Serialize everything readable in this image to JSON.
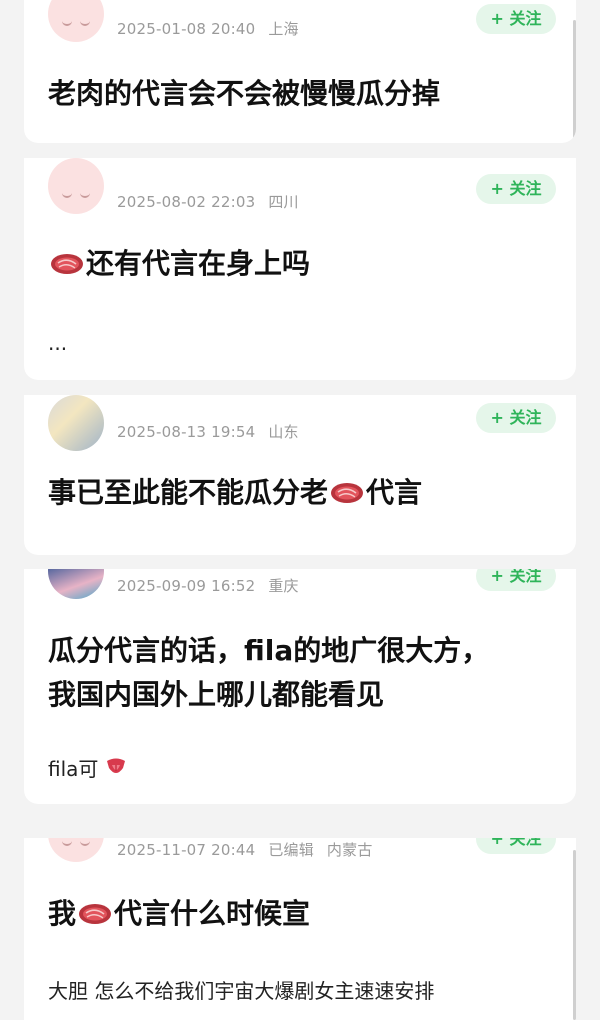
{
  "posts": [
    {
      "date": "2025-01-08 20:40",
      "location": "上海",
      "follow_label": "+ 关注",
      "title": "老肉的代言会不会被慢慢瓜分掉"
    },
    {
      "date": "2025-08-02 22:03",
      "location": "四川",
      "follow_label": "+ 关注",
      "title": "还有代言在身上吗",
      "body": "..."
    },
    {
      "date": "2025-08-13 19:54",
      "location": "山东",
      "follow_label": "+ 关注",
      "title_a": "事已至此能不能瓜分老",
      "title_b": "代言"
    },
    {
      "date": "2025-09-09 16:52",
      "location": "重庆",
      "follow_label": "+ 关注",
      "title_line1": "瓜分代言的话，fila的地广很大方，",
      "title_line2": "我国内国外上哪儿都能看见",
      "body": "fila可"
    },
    {
      "date": "2025-11-07 20:44",
      "edited": "已编辑",
      "location": "内蒙古",
      "follow_label": "+ 关注",
      "title_a": "我",
      "title_b": "代言什么时候宣",
      "body": "大胆 怎么不给我们宇宙大爆剧女主速速安排"
    }
  ],
  "icons": {
    "steak": "steak-emoji",
    "tongue": "tongue-emoji"
  },
  "colors": {
    "follow_bg": "#e5f6ea",
    "follow_text": "#2fb45a",
    "meta_text": "#9a9a9a"
  }
}
